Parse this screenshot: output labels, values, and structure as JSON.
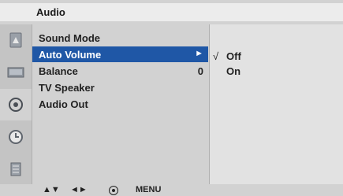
{
  "header": {
    "title": "Audio"
  },
  "icons": [
    {
      "name": "picture-icon"
    },
    {
      "name": "screen-icon"
    },
    {
      "name": "audio-icon"
    },
    {
      "name": "time-icon"
    },
    {
      "name": "option-icon"
    }
  ],
  "menu": {
    "items": [
      {
        "label": "Sound Mode",
        "value": ""
      },
      {
        "label": "Auto Volume",
        "value": "►"
      },
      {
        "label": "Balance",
        "value": "0"
      },
      {
        "label": "TV Speaker",
        "value": ""
      },
      {
        "label": "Audio Out",
        "value": ""
      }
    ],
    "selected_index": 1
  },
  "submenu": {
    "options": [
      {
        "label": "Off",
        "check": "√"
      },
      {
        "label": "On",
        "check": ""
      }
    ]
  },
  "footer": {
    "updown": "▲▼",
    "leftright": "◄►",
    "menu_label": "MENU"
  },
  "colors": {
    "highlight": "#1f57a6",
    "background": "#d2d2d2"
  }
}
